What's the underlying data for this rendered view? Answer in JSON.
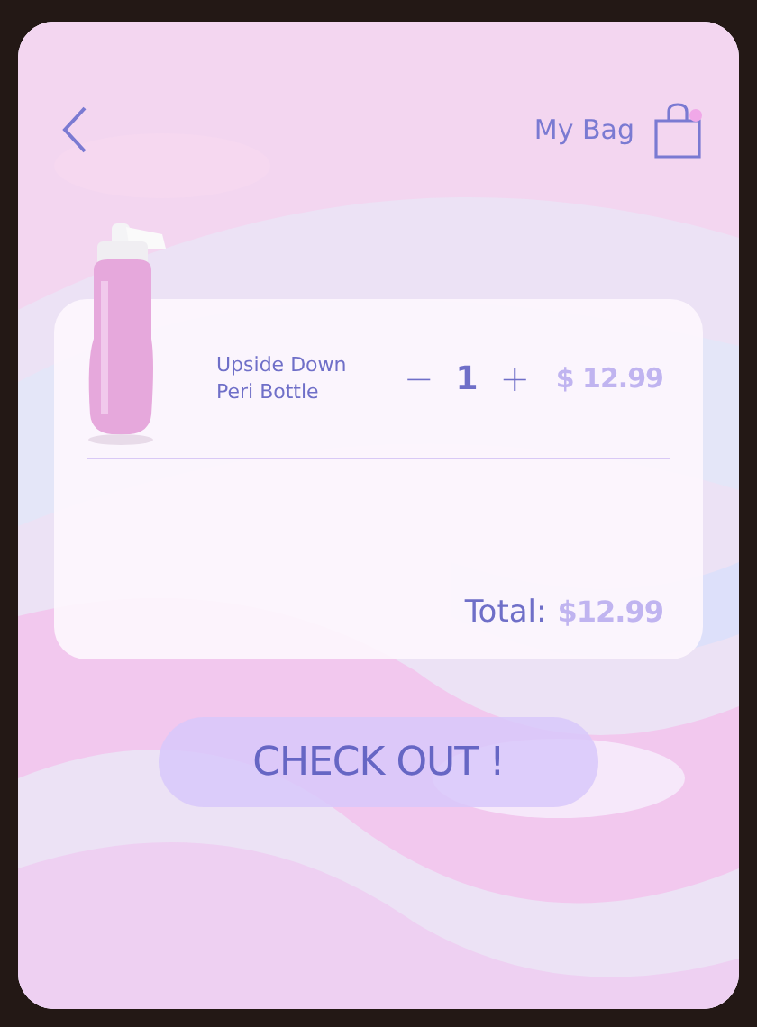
{
  "header": {
    "title": "My Bag",
    "bag_notification": true
  },
  "items": [
    {
      "name": "Upside Down Peri Bottle",
      "quantity": "1",
      "minus": "−",
      "plus": "+",
      "price": "$ 12.99"
    }
  ],
  "total": {
    "label": "Total:",
    "value": "$12.99"
  },
  "checkout_button": "CHECK OUT !"
}
